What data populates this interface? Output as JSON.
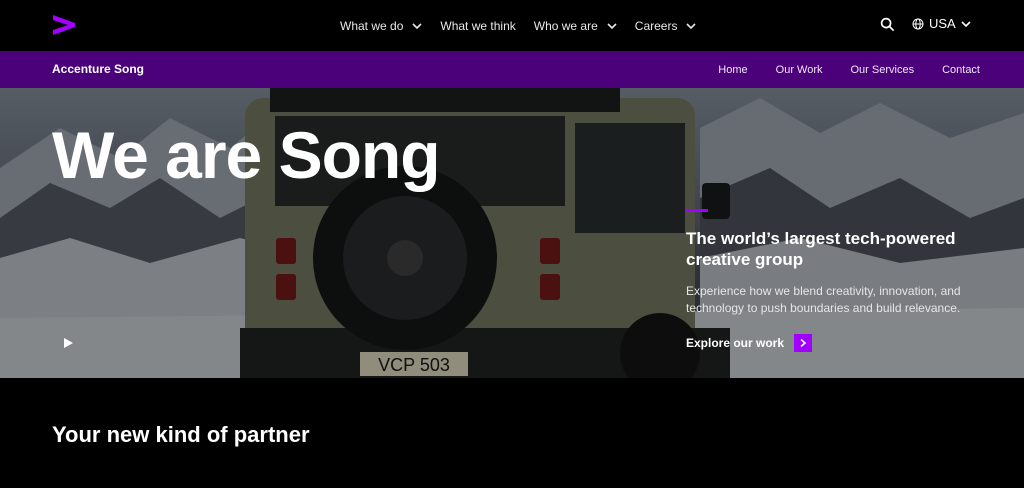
{
  "header": {
    "nav": [
      {
        "label": "What we do",
        "has_dropdown": true
      },
      {
        "label": "What we think",
        "has_dropdown": false
      },
      {
        "label": "Who we are",
        "has_dropdown": true
      },
      {
        "label": "Careers",
        "has_dropdown": true
      }
    ],
    "region": "USA"
  },
  "subheader": {
    "brand": "Accenture Song",
    "links": [
      "Home",
      "Our Work",
      "Our Services",
      "Contact"
    ]
  },
  "hero": {
    "title": "We are Song",
    "tagline": "The world’s largest tech-powered creative group",
    "description": "Experience how we blend creativity, innovation, and technology to push boundaries and build relevance.",
    "cta": "Explore our work",
    "plate": "VCP 503"
  },
  "section": {
    "heading": "Your new kind of partner"
  },
  "colors": {
    "brand_purple": "#a100ff",
    "subbar_purple": "#4a0179"
  }
}
